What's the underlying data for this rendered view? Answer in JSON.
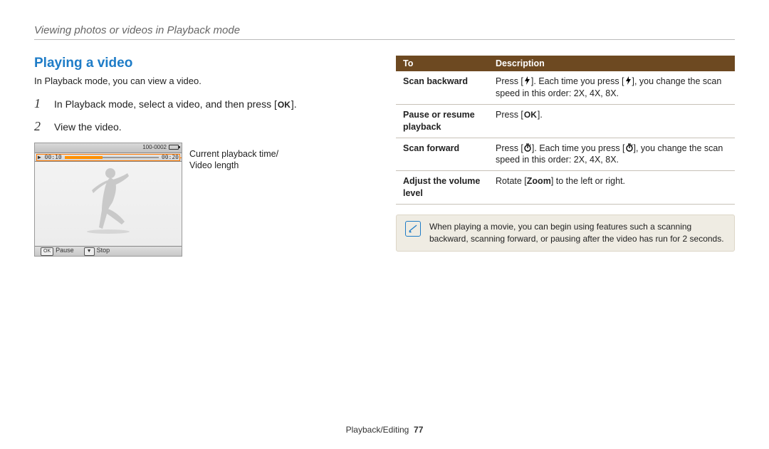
{
  "breadcrumb": "Viewing photos or videos in Playback mode",
  "section_title": "Playing a video",
  "lead": "In Playback mode, you can view a video.",
  "steps": {
    "one_num": "1",
    "one_pre": "In Playback mode, select a video, and then press [",
    "one_btn": "OK",
    "one_post": "].",
    "two_num": "2",
    "two_text": "View the video."
  },
  "screenshot": {
    "time_left": "▶ 00:10",
    "time_right": "00:20",
    "counter": "100-0002",
    "pause_key": "OK",
    "pause_label": "Pause",
    "stop_key": "▼",
    "stop_label": "Stop"
  },
  "annotation": {
    "line1": "Current playback time/",
    "line2": "Video length"
  },
  "table": {
    "head_to": "To",
    "head_desc": "Description",
    "rows": [
      {
        "to": "Scan backward",
        "desc_pre": "Press [",
        "desc_sym": "flash",
        "desc_mid": "]. Each time you press [",
        "desc_sym2": "flash",
        "desc_post": "], you change the scan speed in this order: 2X, 4X, 8X."
      },
      {
        "to": "Pause or resume playback",
        "desc_pre": "Press [",
        "desc_btn": "OK",
        "desc_post": "]."
      },
      {
        "to": "Scan forward",
        "desc_pre": "Press [",
        "desc_sym": "timer",
        "desc_mid": "]. Each time you press [",
        "desc_sym2": "timer",
        "desc_post": "], you change the scan speed in this order: 2X, 4X, 8X."
      },
      {
        "to": "Adjust the volume level",
        "desc_pre": "Rotate [",
        "desc_bold": "Zoom",
        "desc_post": "] to the left or right."
      }
    ]
  },
  "note": "When playing a movie, you can begin using features such a scanning backward, scanning forward, or pausing after the video has run for 2 seconds.",
  "footer": {
    "section": "Playback/Editing",
    "page": "77"
  }
}
